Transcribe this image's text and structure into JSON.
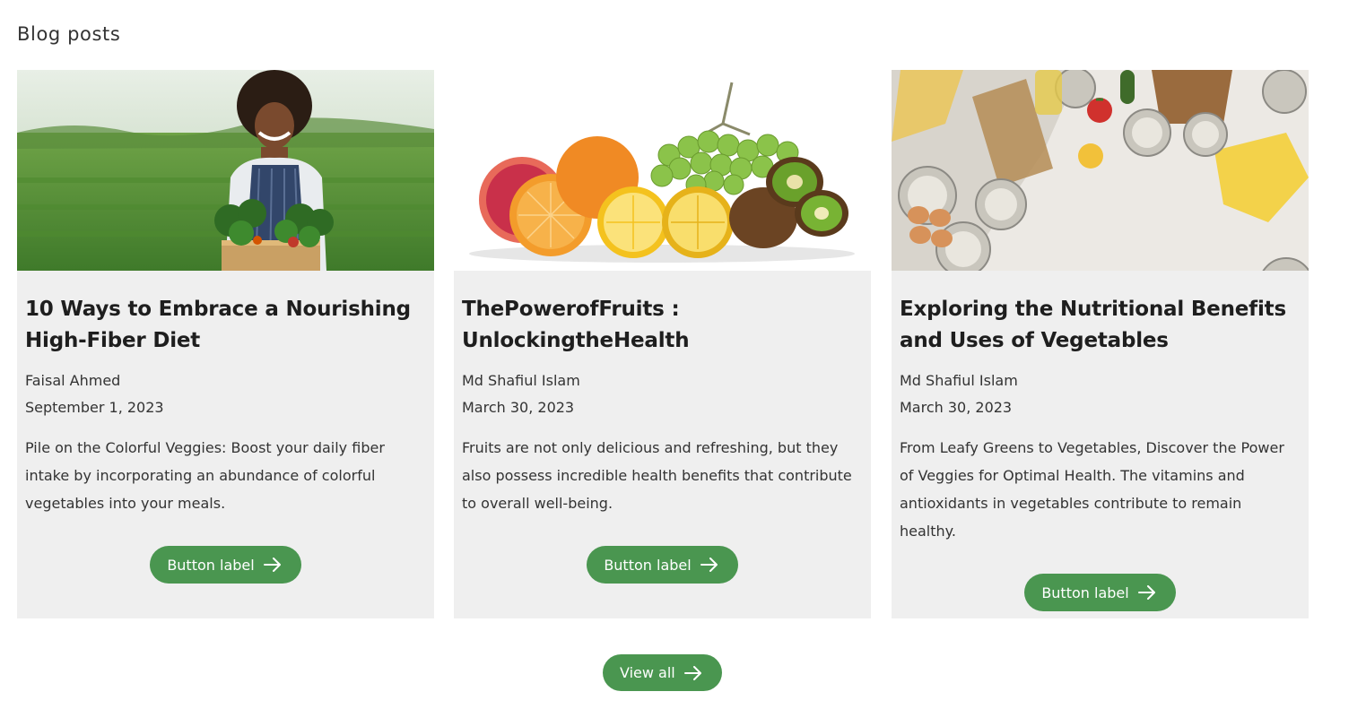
{
  "section": {
    "title": "Blog posts"
  },
  "posts": [
    {
      "title": "10 Ways to Embrace a Nourishing High-Fiber Diet",
      "author": "Faisal Ahmed",
      "date": "September 1, 2023",
      "excerpt": "Pile on the Colorful Veggies: Boost your daily fiber intake by incorporating an abundance of colorful vegetables into your meals.",
      "button_label": "Button label",
      "image_alt": "farmer-with-vegetables-photo"
    },
    {
      "title": "ThePowerofFruits : UnlockingtheHealth",
      "author": "Md Shafiul Islam",
      "date": "March 30, 2023",
      "excerpt": "Fruits are not only delicious and refreshing, but they also possess incredible health benefits that contribute to overall well-being.",
      "button_label": "Button label",
      "image_alt": "fruits-photo"
    },
    {
      "title": "Exploring the Nutritional Benefits and Uses of Vegetables",
      "author": "Md Shafiul Islam",
      "date": "March 30, 2023",
      "excerpt": "From Leafy Greens to Vegetables, Discover the Power of Veggies for Optimal Health. The vitamins and antioxidants in vegetables contribute to remain healthy.",
      "button_label": "Button label",
      "image_alt": "groceries-photo"
    }
  ],
  "footer": {
    "view_all_label": "View all"
  },
  "colors": {
    "button": "#4a9650",
    "card_bg": "#efefef",
    "text": "#333333"
  },
  "icons": {
    "button_icon": "arrow-right-icon"
  }
}
